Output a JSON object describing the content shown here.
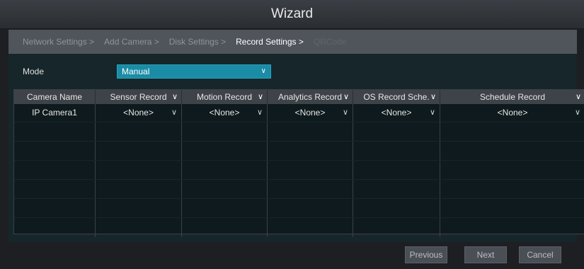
{
  "window": {
    "title": "Wizard"
  },
  "steps": [
    {
      "label": "Network Settings >",
      "state": "done"
    },
    {
      "label": "Add Camera >",
      "state": "done"
    },
    {
      "label": "Disk Settings >",
      "state": "done"
    },
    {
      "label": "Record Settings >",
      "state": "active"
    },
    {
      "label": "QRCode",
      "state": "pending"
    }
  ],
  "mode": {
    "label": "Mode",
    "value": "Manual"
  },
  "table": {
    "columns": [
      "Camera Name",
      "Sensor Record",
      "Motion Record",
      "Analytics Record",
      "OS Record Sche.",
      "Schedule Record"
    ],
    "rows": [
      [
        "IP Camera1",
        "<None>",
        "<None>",
        "<None>",
        "<None>",
        "<None>"
      ]
    ]
  },
  "buttons": {
    "previous": "Previous",
    "next": "Next",
    "cancel": "Cancel"
  },
  "colors": {
    "accent": "#1b8ca6",
    "panel": "#16262a",
    "header": "#3e4349"
  }
}
